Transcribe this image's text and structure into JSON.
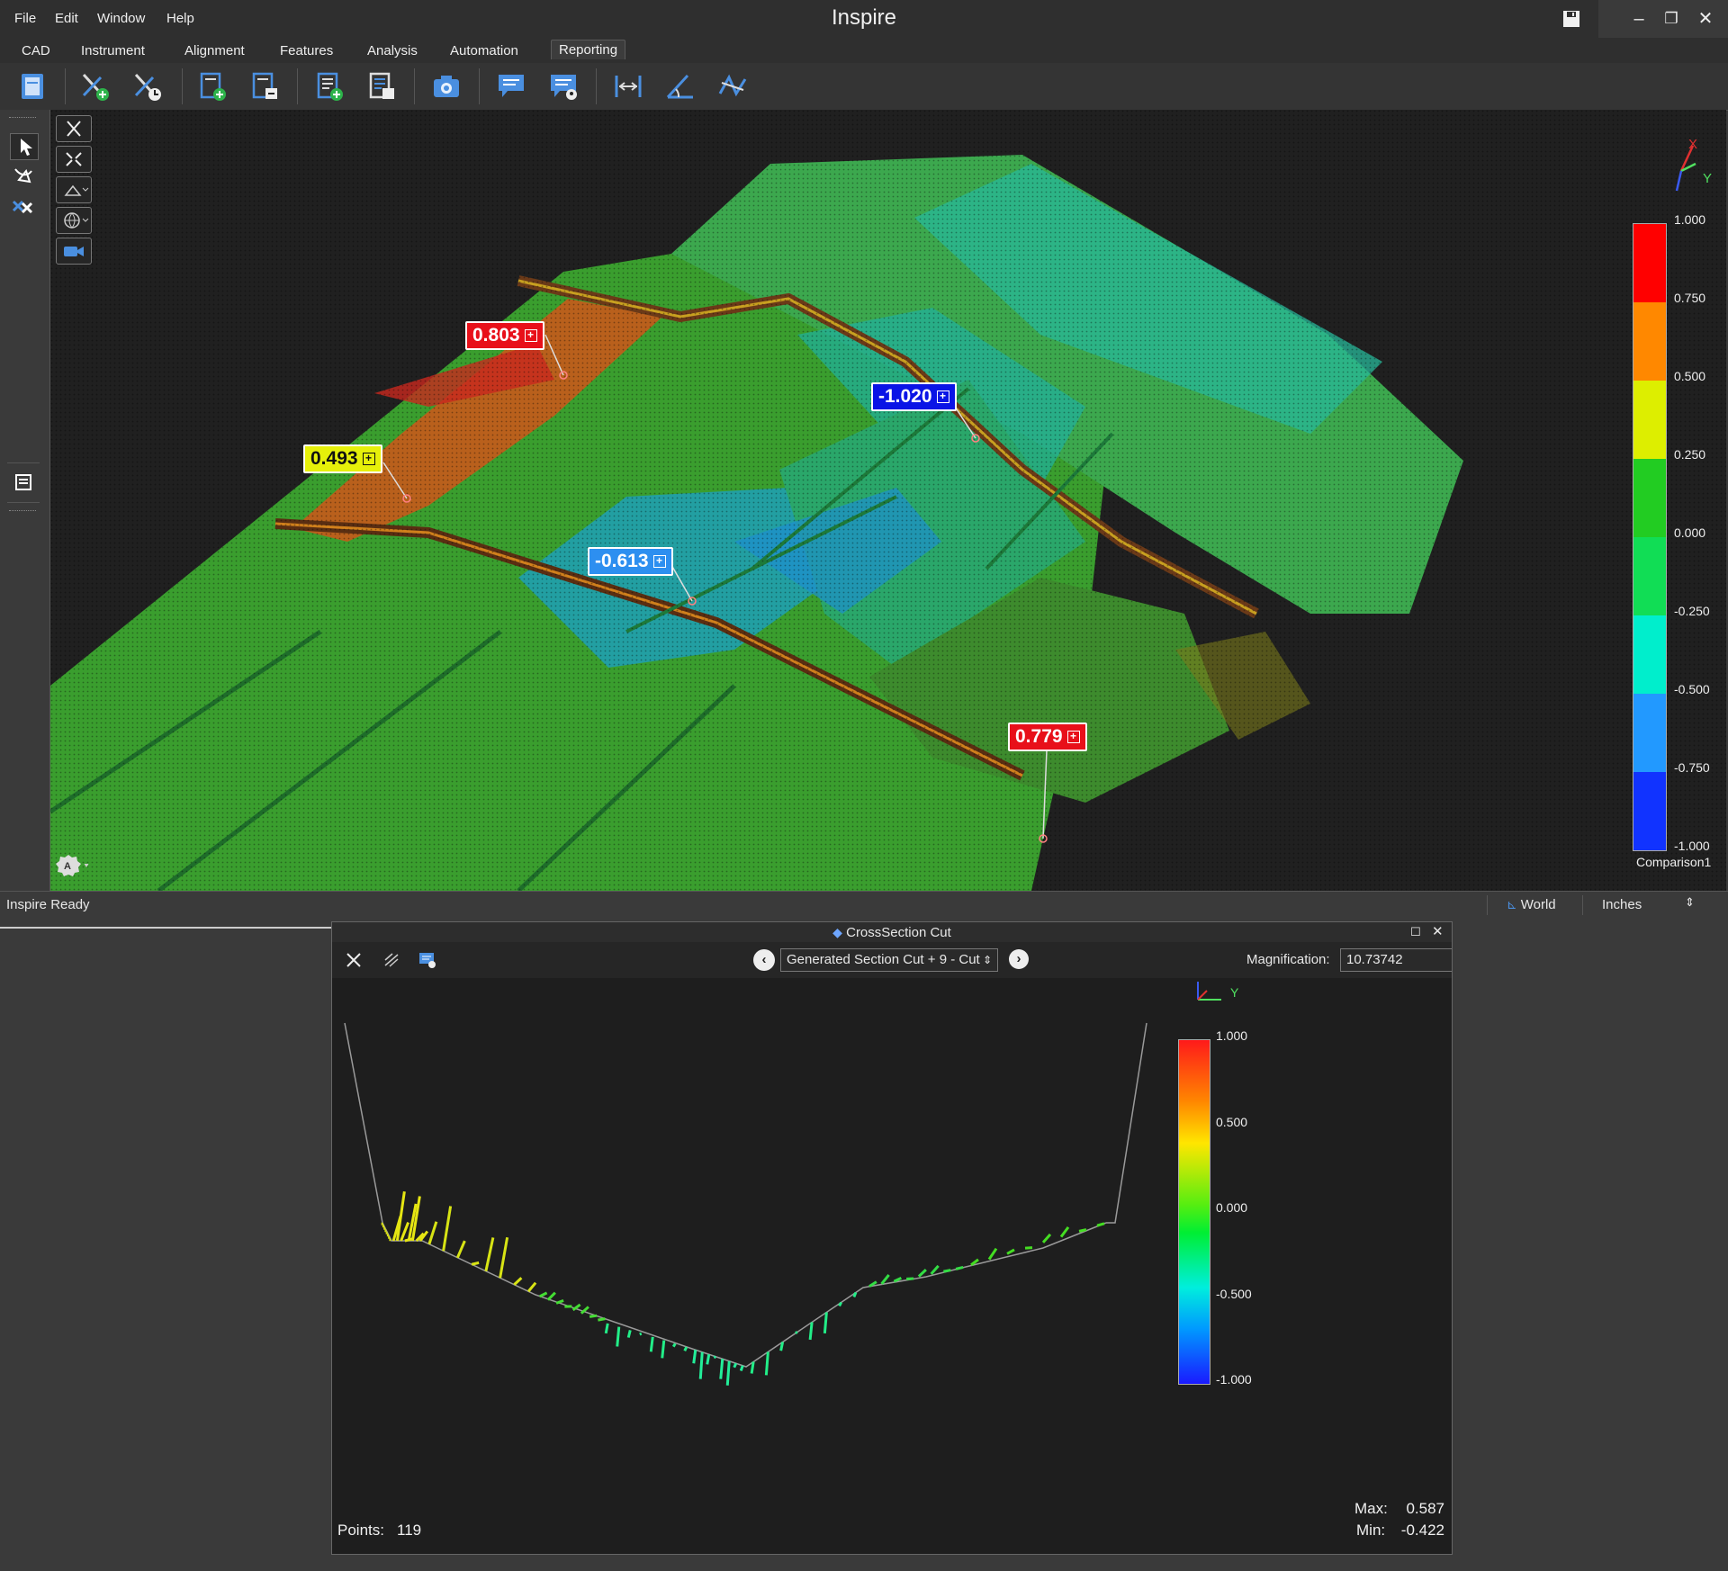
{
  "app": {
    "title": "Inspire",
    "menus": [
      "File",
      "Edit",
      "Window",
      "Help"
    ],
    "tabs": [
      "CAD",
      "Instrument",
      "Alignment",
      "Features",
      "Analysis",
      "Automation",
      "Reporting"
    ],
    "active_tab": "Reporting"
  },
  "toolbar": {
    "icons": [
      "report-icon",
      "add-note-icon",
      "remove-note-icon",
      "add-page-icon",
      "replace-page-icon",
      "add-list-icon",
      "edit-list-icon",
      "camera-icon",
      "comment-icon",
      "comment-location-icon",
      "distance-icon",
      "angle-icon",
      "polyline-icon"
    ]
  },
  "viewport": {
    "callouts": [
      {
        "value": "0.803",
        "bg": "#e8101a",
        "fg": "#ffffff"
      },
      {
        "value": "0.493",
        "bg": "#e6f00a",
        "fg": "#111111"
      },
      {
        "value": "-1.020",
        "bg": "#0a14e6",
        "fg": "#ffffff"
      },
      {
        "value": "-0.613",
        "bg": "#2d8ff0",
        "fg": "#ffffff"
      },
      {
        "value": "0.779",
        "bg": "#e8101a",
        "fg": "#ffffff"
      }
    ],
    "axis_labels": {
      "x": "X",
      "y": "Y"
    },
    "colorbar": {
      "ticks": [
        "1.000",
        "0.750",
        "0.500",
        "0.250",
        "0.000",
        "-0.250",
        "-0.500",
        "-0.750",
        "-1.000"
      ],
      "colors": [
        "#ff0000",
        "#ff8800",
        "#ddee00",
        "#22cc22",
        "#11dd55",
        "#00eecc",
        "#2299ff",
        "#1133ff"
      ],
      "name": "Comparison1"
    }
  },
  "status": {
    "text": "Inspire Ready",
    "coord_system": "World",
    "units": "Inches"
  },
  "cross_section": {
    "title": "CrossSection Cut",
    "section_name": "Generated Section Cut + 9 - Cut",
    "magnification_label": "Magnification:",
    "magnification_value": "10.73742",
    "axis_y_label": "Y",
    "colorbar_ticks": [
      "1.000",
      "0.500",
      "0.000",
      "-0.500",
      "-1.000"
    ],
    "points_label": "Points:",
    "points_value": "119",
    "max_label": "Max:",
    "max_value": "0.587",
    "min_label": "Min:",
    "min_value": "-0.422"
  }
}
